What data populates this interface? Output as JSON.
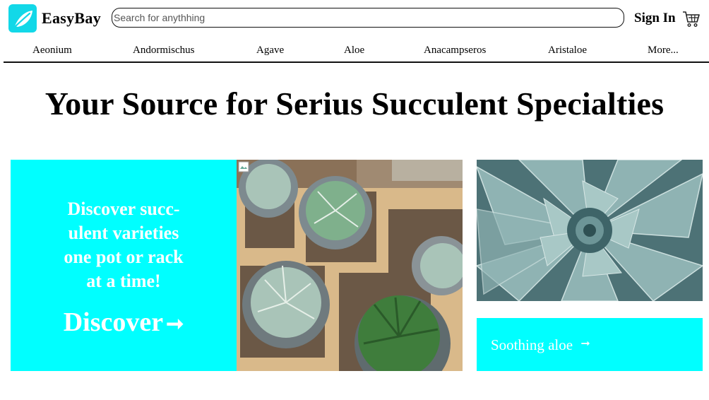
{
  "header": {
    "brand": "EasyBay",
    "search_placeholder": "Search for anythhing",
    "sign_in": "Sign In"
  },
  "nav": [
    "Aeonium",
    "Andormischus",
    "Agave",
    "Aloe",
    "Anacampseros",
    "Aristaloe",
    "More..."
  ],
  "hero": {
    "headline": "Your Source for Serius Succulent Specialties",
    "promo_lines": [
      "Discover succ-",
      "ulent varieties",
      "one pot or rack",
      "at a time!"
    ],
    "promo_cta": "Discover",
    "promo_cta_arrow": "➞",
    "aloe_link": "Soothing aloe",
    "aloe_arrow": "➞"
  },
  "colors": {
    "accent": "#00ffff",
    "logo": "#12d8e8"
  },
  "icons": {
    "logo": "leaf-icon",
    "cart": "cart-icon",
    "arrow": "arrow-right-icon"
  }
}
